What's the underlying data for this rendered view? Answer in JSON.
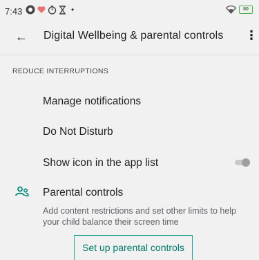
{
  "status_bar": {
    "time": "7:43",
    "icons": [
      "circle-app-icon",
      "heart-icon",
      "timer-icon",
      "hourglass-icon",
      "dot-icon"
    ],
    "right_icons": [
      "wifi-icon",
      "battery-icon"
    ],
    "battery_level": "80"
  },
  "toolbar": {
    "back_icon": "arrow-left-icon",
    "title": "Digital Wellbeing & parental controls",
    "more_icon": "more-vert-icon"
  },
  "section": {
    "header": "REDUCE INTERRUPTIONS",
    "items": [
      {
        "label": "Manage notifications"
      },
      {
        "label": "Do Not Disturb"
      },
      {
        "label": "Show icon in the app list",
        "toggle_on": false
      }
    ]
  },
  "parental": {
    "icon": "parental-controls-icon",
    "title": "Parental controls",
    "description": "Add content restrictions and set other limits to help your child balance their screen time",
    "button": "Set up parental controls"
  },
  "colors": {
    "background": "#f1f1f1",
    "accent": "#00796b",
    "accent_border": "#26a69a",
    "battery": "#4caf50"
  }
}
